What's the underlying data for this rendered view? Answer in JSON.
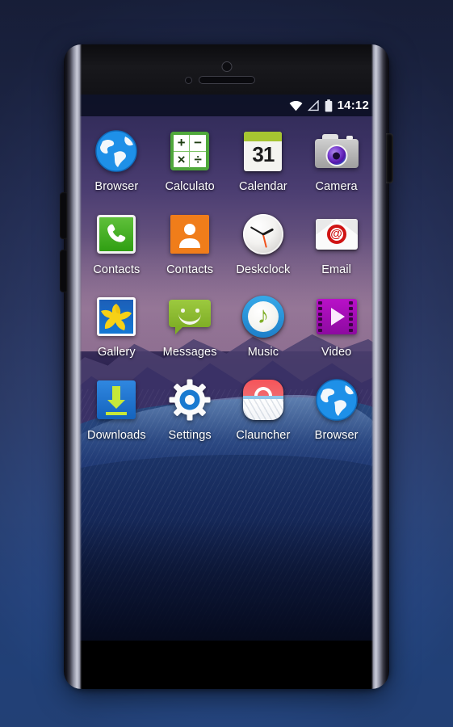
{
  "device": {
    "name": "smartphone-mockup",
    "hardware": {
      "front_camera": "front-camera",
      "proximity_sensor": "proximity-sensor",
      "earpiece": "earpiece-speaker",
      "volume_up": "volume-up-button",
      "volume_down": "volume-down-button",
      "power": "power-button"
    }
  },
  "statusbar": {
    "wifi_icon": "wifi-icon",
    "signal_icon": "signal-icon",
    "battery_icon": "battery-icon",
    "time": "14:12"
  },
  "wallpaper": {
    "description": "purple dusk sky over dark mountains with blue dunes",
    "sky_color": "#6a5580",
    "mountain_color": "#3a3166",
    "dune_color": "#1d3470"
  },
  "colors": {
    "page_background_top": "#1d2647",
    "page_background_bottom": "#2a5298",
    "bezel": "#000000",
    "screen_accent": "#2b2250",
    "label_text": "#ffffff"
  },
  "home_screen": {
    "apps": [
      {
        "label": "Browser",
        "icon": "globe-icon",
        "row": 1,
        "col": 1
      },
      {
        "label": "Calculato",
        "icon": "calculator-icon",
        "row": 1,
        "col": 2
      },
      {
        "label": "Calendar",
        "icon": "calendar-icon",
        "row": 1,
        "col": 3,
        "day": "31"
      },
      {
        "label": "Camera",
        "icon": "camera-icon",
        "row": 1,
        "col": 4
      },
      {
        "label": "Contacts",
        "icon": "phone-icon",
        "row": 2,
        "col": 1
      },
      {
        "label": "Contacts",
        "icon": "person-icon",
        "row": 2,
        "col": 2
      },
      {
        "label": "Deskclock",
        "icon": "clock-icon",
        "row": 2,
        "col": 3
      },
      {
        "label": "Email",
        "icon": "envelope-at-icon",
        "row": 2,
        "col": 4
      },
      {
        "label": "Gallery",
        "icon": "flower-photo-icon",
        "row": 3,
        "col": 1
      },
      {
        "label": "Messages",
        "icon": "speech-bubble-smiley-icon",
        "row": 3,
        "col": 2
      },
      {
        "label": "Music",
        "icon": "music-note-icon",
        "row": 3,
        "col": 3
      },
      {
        "label": "Video",
        "icon": "film-play-icon",
        "row": 3,
        "col": 4
      },
      {
        "label": "Downloads",
        "icon": "download-arrow-icon",
        "row": 4,
        "col": 1
      },
      {
        "label": "Settings",
        "icon": "gear-icon",
        "row": 4,
        "col": 2
      },
      {
        "label": "Clauncher",
        "icon": "shopping-basket-icon",
        "row": 4,
        "col": 3
      },
      {
        "label": "Browser",
        "icon": "globe-icon",
        "row": 4,
        "col": 4
      }
    ]
  },
  "calculator_icon_symbols": {
    "plus": "+",
    "minus": "−",
    "times": "×",
    "divide": "÷"
  },
  "email_icon_symbol": "@",
  "music_icon_symbol": "♪"
}
